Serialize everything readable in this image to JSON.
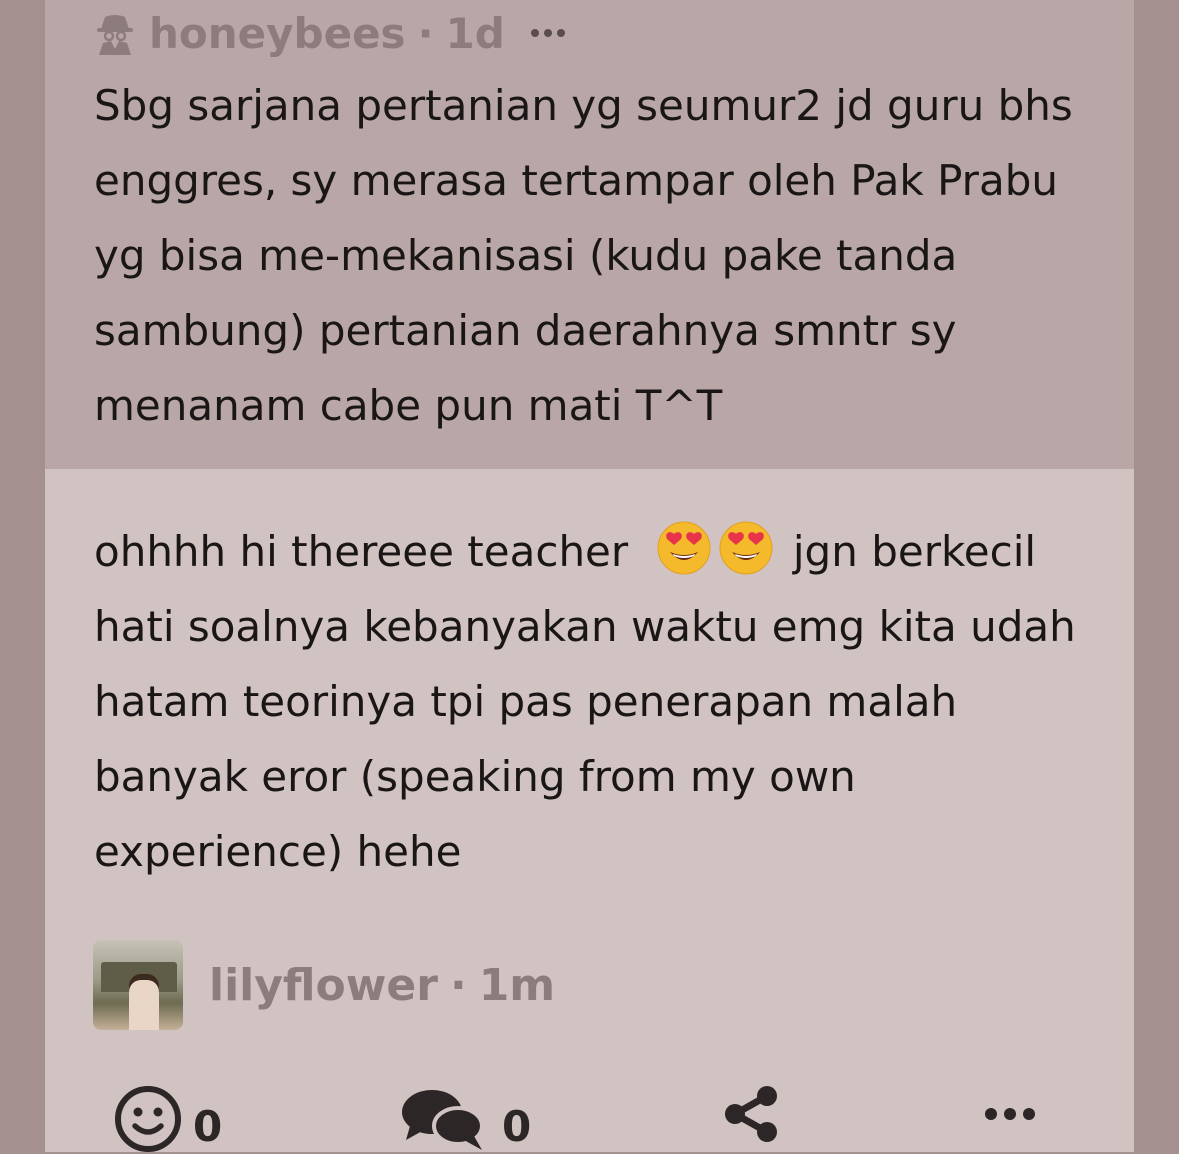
{
  "quoted": {
    "author": "honeybees",
    "separator": "·",
    "time": "1d",
    "icon": "spy-icon",
    "text": "Sbg sarjana pertanian yg seumur2 jd guru bhs enggres, sy merasa tertampar oleh Pak Prabu yg bisa me-mekanisasi (kudu pake tanda sambung) pertanian daerahnya smntr sy menanam cabe pun mati T^T"
  },
  "reply": {
    "text_before": "ohhhh hi thereee teacher",
    "emojis": [
      "heart-eyes-emoji",
      "heart-eyes-emoji"
    ],
    "text_after": "jgn berkecil hati soalnya kebanyakan waktu emg kita udah hatam teorinya tpi pas penerapan malah banyak eror (speaking from my own experience) hehe",
    "author": "lilyflower",
    "separator": "·",
    "time": "1m"
  },
  "actions": {
    "reactions_count": "0",
    "comments_count": "0",
    "icons": [
      "smiley-icon",
      "comments-icon",
      "share-icon",
      "more-icon"
    ]
  },
  "colors": {
    "background": "#a4918f",
    "quoted_bg": "#b9a7a7",
    "reply_bg": "#d2c3c3",
    "muted_text": "#8c7c7c",
    "body_text": "#1a1616"
  }
}
